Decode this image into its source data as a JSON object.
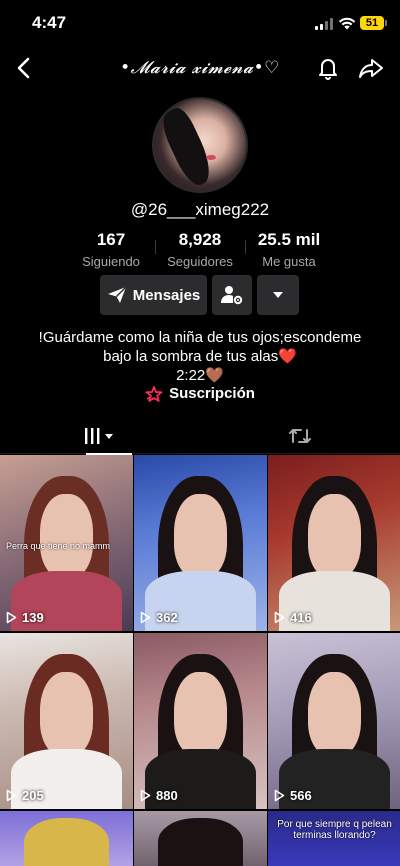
{
  "status_bar": {
    "time": "4:47",
    "battery": "51"
  },
  "header": {
    "title": "•𝓜𝓪𝓻𝓲𝓪 𝔁𝓲𝓶𝓮𝓷𝓪•♡"
  },
  "profile": {
    "username": "@26___ximeg222"
  },
  "stats": [
    {
      "value": "167",
      "label": "Siguiendo"
    },
    {
      "value": "8,928",
      "label": "Seguidores"
    },
    {
      "value": "25.5 mil",
      "label": "Me gusta"
    }
  ],
  "actions": {
    "message_label": "Mensajes"
  },
  "bio": {
    "line1": "!Guárdame como la niña de tus ojos;escondeme",
    "line2": "bajo la sombra de tus alas❤️",
    "line3": "2:22🤎"
  },
  "subscription": {
    "label": "Suscripción"
  },
  "icons": {
    "back": "chevron-left-icon",
    "bell": "bell-icon",
    "share": "share-arrow-icon",
    "message": "paper-plane-icon",
    "add_friend": "person-gear-icon",
    "more": "caret-down-icon",
    "videos_tab": "grid-bars-icon",
    "reposts_tab": "repost-icon",
    "play": "play-outline-icon",
    "subscription": "star-badge-icon"
  },
  "colors": {
    "accent_pink": "#fe2c55",
    "button_bg": "#2c2c2e",
    "muted_text": "#a8a8a8",
    "battery": "#ffd60a"
  },
  "videos": [
    {
      "views": "139",
      "caption": "Perra que tiene no mamm"
    },
    {
      "views": "362",
      "caption": ""
    },
    {
      "views": "416",
      "caption": ""
    },
    {
      "views": "205",
      "caption": ""
    },
    {
      "views": "880",
      "caption": ""
    },
    {
      "views": "566",
      "caption": ""
    },
    {
      "views": "",
      "caption": ""
    },
    {
      "views": "",
      "caption": ""
    },
    {
      "views": "",
      "caption": "Por que siempre q pelean terminas llorando?"
    }
  ]
}
